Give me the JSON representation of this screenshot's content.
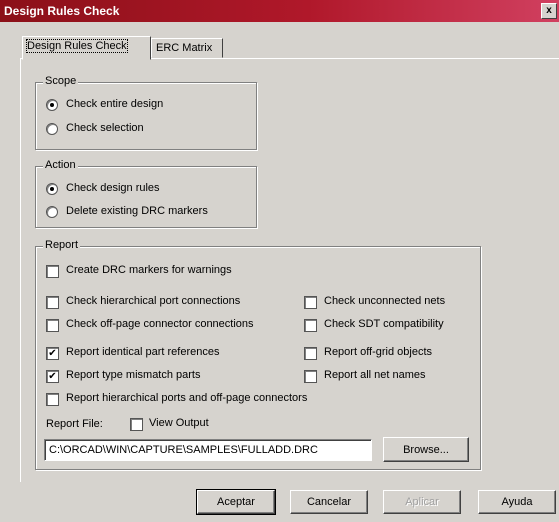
{
  "window": {
    "title": "Design Rules Check",
    "close_glyph": "x"
  },
  "tabs": [
    {
      "label": "Design Rules Check",
      "active": true
    },
    {
      "label": "ERC Matrix",
      "active": false
    }
  ],
  "scope": {
    "legend": "Scope",
    "options": [
      {
        "label": "Check entire design",
        "selected": true
      },
      {
        "label": "Check selection",
        "selected": false
      }
    ]
  },
  "action": {
    "legend": "Action",
    "options": [
      {
        "label": "Check design rules",
        "selected": true
      },
      {
        "label": "Delete existing DRC markers",
        "selected": false
      }
    ]
  },
  "report": {
    "legend": "Report",
    "create_markers": {
      "label": "Create DRC markers for warnings",
      "checked": false
    },
    "left_checks": [
      {
        "label": "Check hierarchical port connections",
        "checked": false
      },
      {
        "label": "Check off-page connector connections",
        "checked": false
      },
      {
        "label": "Report identical part references",
        "checked": true
      },
      {
        "label": "Report type mismatch parts",
        "checked": true
      },
      {
        "label": "Report hierarchical ports and off-page connectors",
        "checked": false
      }
    ],
    "right_checks": [
      {
        "label": "Check unconnected nets",
        "checked": false
      },
      {
        "label": "Check SDT compatibility",
        "checked": false
      },
      {
        "label": "Report off-grid objects",
        "checked": false
      },
      {
        "label": "Report all net names",
        "checked": false
      }
    ],
    "file_label": "Report File:",
    "view_output": {
      "label": "View Output",
      "checked": false
    },
    "file_value": "C:\\ORCAD\\WIN\\CAPTURE\\SAMPLES\\FULLADD.DRC",
    "browse_label": "Browse..."
  },
  "buttons": {
    "ok": "Aceptar",
    "cancel": "Cancelar",
    "apply": "Aplicar",
    "help": "Ayuda"
  }
}
